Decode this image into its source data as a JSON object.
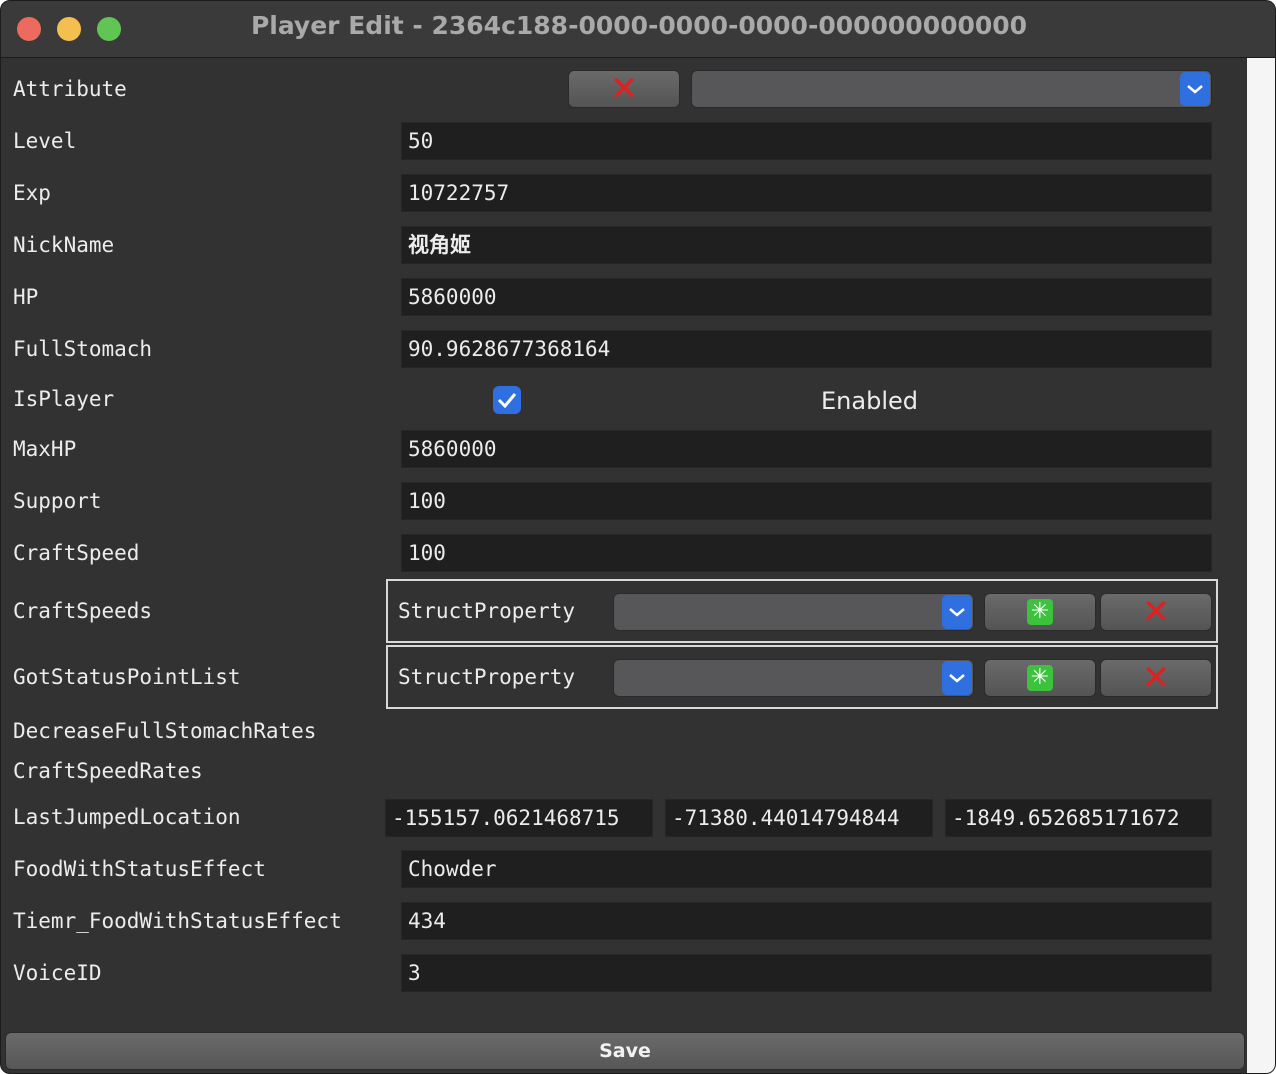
{
  "window": {
    "title": "Player Edit - 2364c188-0000-0000-0000-000000000000"
  },
  "attribute": {
    "label": "Attribute",
    "remove_glyph": "✕",
    "selected": ""
  },
  "rows": {
    "level": {
      "label": "Level",
      "value": "50"
    },
    "exp": {
      "label": "Exp",
      "value": "10722757"
    },
    "nickname": {
      "label": "NickName",
      "value": "视角姬"
    },
    "hp": {
      "label": "HP",
      "value": "5860000"
    },
    "fullstomach": {
      "label": "FullStomach",
      "value": "90.9628677368164"
    },
    "maxhp": {
      "label": "MaxHP",
      "value": "5860000"
    },
    "support": {
      "label": "Support",
      "value": "100"
    },
    "craftspeed": {
      "label": "CraftSpeed",
      "value": "100"
    },
    "food": {
      "label": "FoodWithStatusEffect",
      "value": "Chowder"
    },
    "timer": {
      "label": "Tiemr_FoodWithStatusEffect",
      "value": "434"
    },
    "voiceid": {
      "label": "VoiceID",
      "value": "3"
    }
  },
  "isplayer": {
    "label": "IsPlayer",
    "checked": true,
    "state_text": "Enabled"
  },
  "craftspeeds": {
    "label": "CraftSpeeds",
    "type": "StructProperty",
    "selected": ""
  },
  "gotstatus": {
    "label": "GotStatusPointList",
    "type": "StructProperty",
    "selected": ""
  },
  "decrease": {
    "label": "DecreaseFullStomachRates"
  },
  "craftspeedrates": {
    "label": "CraftSpeedRates"
  },
  "lastjumped": {
    "label": "LastJumpedLocation",
    "x": "-155157.0621468715",
    "y": "-71380.44014794844",
    "z": "-1849.652685171672"
  },
  "icons": {
    "remove": "x-icon",
    "add": "add-icon",
    "dropdown": "chevron-down-icon",
    "check": "check-icon"
  },
  "colors": {
    "accent": "#2f6fe0",
    "remove": "#e02020",
    "add": "#3cc23c"
  },
  "save_label": "Save"
}
